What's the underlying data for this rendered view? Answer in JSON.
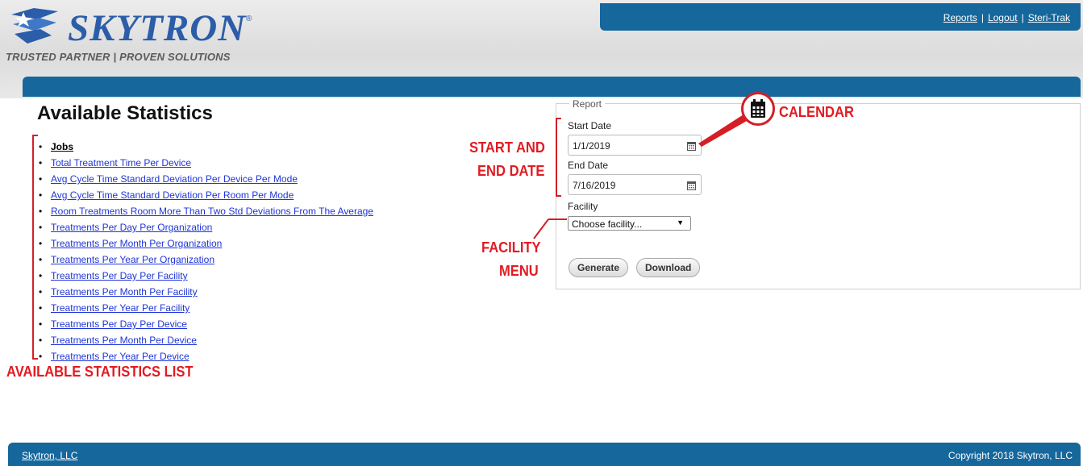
{
  "brand": {
    "wordmark": "SKYTRON",
    "registered": "®",
    "tagline": "TRUSTED PARTNER | PROVEN SOLUTIONS",
    "color": "#2b5da9"
  },
  "topnav": {
    "links": [
      "Reports",
      "Logout",
      "Steri-Trak"
    ],
    "separator": "|"
  },
  "page": {
    "title": "Available Statistics"
  },
  "stats": [
    "Jobs",
    "Total Treatment Time Per Device",
    "Avg Cycle Time Standard Deviation Per Device Per Mode",
    "Avg Cycle Time Standard Deviation Per Room Per Mode",
    "Room Treatments Room More Than Two Std Deviations From The Average",
    "Treatments Per Day Per Organization",
    "Treatments Per Month Per Organization",
    "Treatments Per Year Per Organization",
    "Treatments Per Day Per Facility",
    "Treatments Per Month Per Facility",
    "Treatments Per Year Per Facility",
    "Treatments Per Day Per Device",
    "Treatments Per Month Per Device",
    "Treatments Per Year Per Device"
  ],
  "report": {
    "legend": "Report",
    "start_label": "Start Date",
    "start_value": "1/1/2019",
    "end_label": "End Date",
    "end_value": "7/16/2019",
    "facility_label": "Facility",
    "facility_value": "Choose facility...",
    "generate": "Generate",
    "download": "Download"
  },
  "annotations": {
    "calendar": "CALENDAR",
    "dates_line1": "START AND",
    "dates_line2": "END DATE",
    "facility_line1": "FACILITY",
    "facility_line2": "MENU",
    "stats_list": "AVAILABLE STATISTICS LIST",
    "color": "#e21b22"
  },
  "footer": {
    "company_link": "Skytron, LLC",
    "copyright": "Copyright 2018 Skytron, LLC"
  },
  "colors": {
    "bar": "#15679c",
    "link": "#1f35d6"
  }
}
